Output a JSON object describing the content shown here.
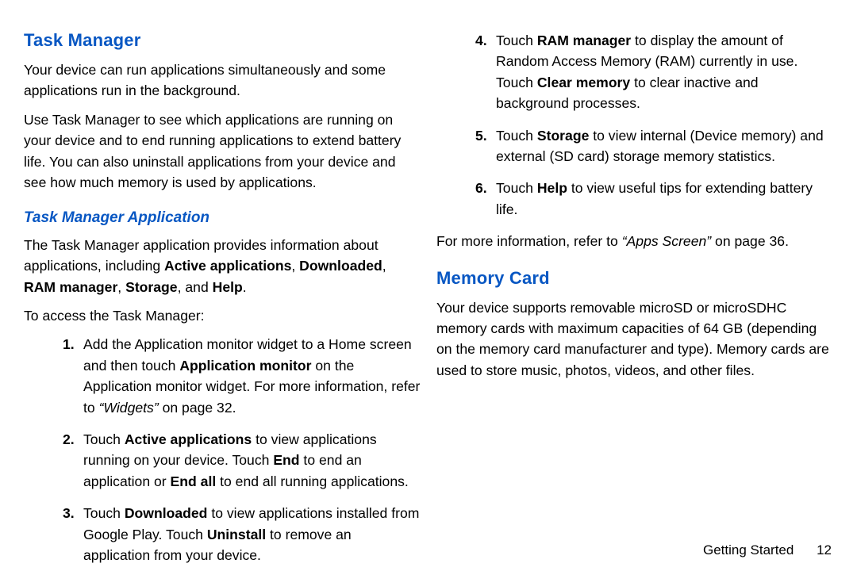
{
  "left": {
    "heading_task_manager": "Task Manager",
    "p1": "Your device can run applications simultaneously and some applications run in the background.",
    "p2": "Use Task Manager to see which applications are running on your device and to end running applications to extend battery life. You can also uninstall applications from your device and see how much memory is used by applications.",
    "subheading_task_manager_app": "Task Manager Application",
    "p3": {
      "t1": "The Task Manager application provides information about applications, including ",
      "b1": "Active applications",
      "s1": ", ",
      "b2": "Downloaded",
      "s2": ", ",
      "b3": "RAM manager",
      "s3": ", ",
      "b4": "Storage",
      "s4": ", and ",
      "b5": "Help",
      "s5": "."
    },
    "p4": "To access the Task Manager:",
    "steps": [
      {
        "num": "1.",
        "t1": "Add the Application monitor widget to a Home screen and then touch ",
        "b1": "Application monitor",
        "t2": " on the Application monitor widget. For more information, refer to ",
        "i1": "“Widgets”",
        "t3": " on page 32."
      },
      {
        "num": "2.",
        "t1": "Touch ",
        "b1": "Active applications",
        "t2": " to view applications running on your device. Touch ",
        "b2": "End",
        "t3": " to end an application or ",
        "b3": "End all",
        "t4": " to end all running applications."
      },
      {
        "num": "3.",
        "t1": "Touch ",
        "b1": "Downloaded",
        "t2": " to view applications installed from Google Play. Touch ",
        "b2": "Uninstall",
        "t3": " to remove an application from your device."
      }
    ]
  },
  "right": {
    "steps": [
      {
        "num": "4.",
        "t1": "Touch ",
        "b1": "RAM manager",
        "t2": " to display the amount of Random Access Memory (RAM) currently in use. Touch ",
        "b2": "Clear memory",
        "t3": " to clear inactive and background processes."
      },
      {
        "num": "5.",
        "t1": "Touch ",
        "b1": "Storage",
        "t2": " to view internal (Device memory) and external (SD card) storage memory statistics."
      },
      {
        "num": "6.",
        "t1": "Touch ",
        "b1": "Help",
        "t2": " to view useful tips for extending battery life."
      }
    ],
    "p_link": {
      "t1": "For more information, refer to ",
      "i1": "“Apps Screen”",
      "t2": " on page 36."
    },
    "heading_memory_card": "Memory Card",
    "p1": "Your device supports removable microSD or microSDHC memory cards with maximum capacities of 64 GB (depending on the memory card manufacturer and type). Memory cards are used to store music, photos, videos, and other files."
  },
  "footer": {
    "section": "Getting Started",
    "page": "12"
  }
}
